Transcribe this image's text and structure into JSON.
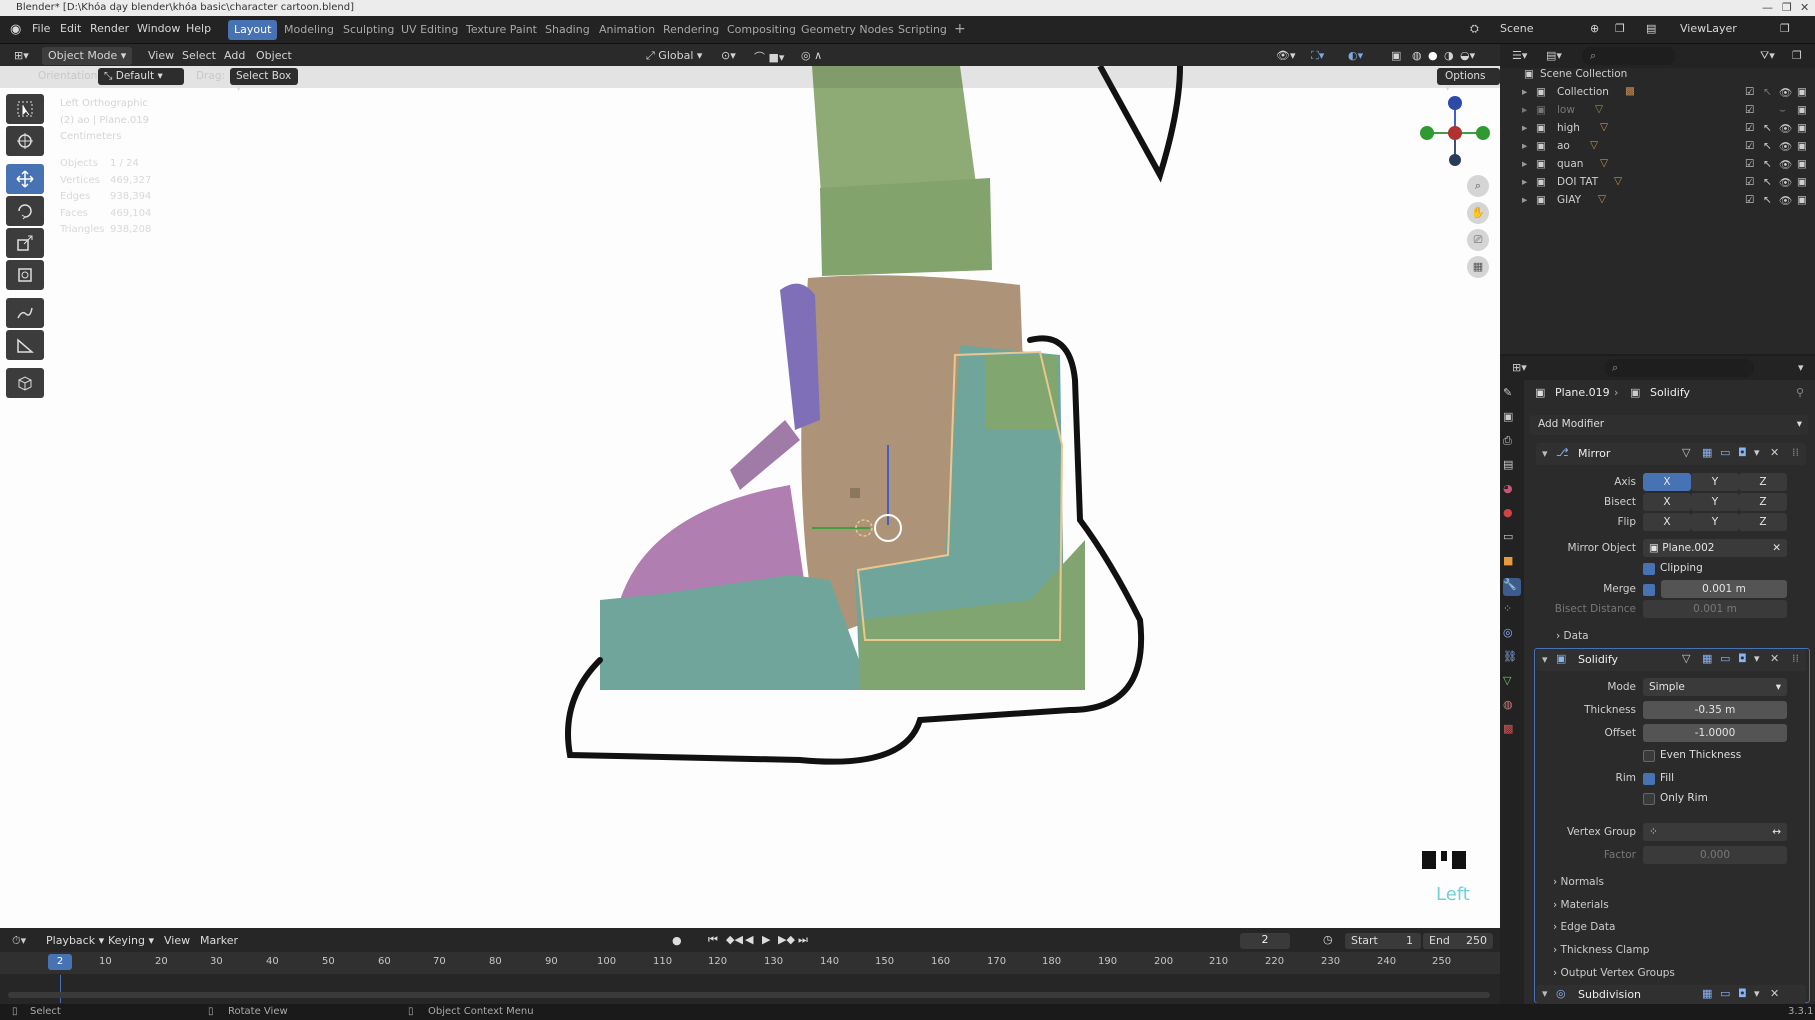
{
  "window": {
    "title": "Blender* [D:\\Khóa dạy blender\\khóa basic\\character cartoon.blend]"
  },
  "menu": [
    "File",
    "Edit",
    "Render",
    "Window",
    "Help"
  ],
  "workspaces": [
    "Layout",
    "Modeling",
    "Sculpting",
    "UV Editing",
    "Texture Paint",
    "Shading",
    "Animation",
    "Rendering",
    "Compositing",
    "Geometry Nodes",
    "Scripting"
  ],
  "scene": {
    "label": "Scene",
    "viewlayer": "ViewLayer"
  },
  "viewport_header": {
    "mode": "Object Mode",
    "menus": [
      "View",
      "Select",
      "Add",
      "Object"
    ],
    "transform": "Global",
    "options": "Options"
  },
  "tool_settings": {
    "orientation_label": "Orientation:",
    "orientation": "Default",
    "drag_label": "Drag:",
    "drag": "Select Box"
  },
  "overlay_info": {
    "lines": [
      "Left Orthographic",
      "(2) ao | Plane.019",
      "Centimeters"
    ],
    "stats": [
      {
        "k": "Objects",
        "v": "1 / 24"
      },
      {
        "k": "Vertices",
        "v": "469,327"
      },
      {
        "k": "Edges",
        "v": "938,394"
      },
      {
        "k": "Faces",
        "v": "469,104"
      },
      {
        "k": "Triangles",
        "v": "938,208"
      }
    ],
    "view_label": "Left"
  },
  "outliner": {
    "root": "Scene Collection",
    "items": [
      "Collection",
      "low",
      "high",
      "ao",
      "quan",
      "DOI TAT",
      "GIAY"
    ]
  },
  "properties": {
    "breadcrumb_object": "Plane.019",
    "breadcrumb_modifier": "Solidify",
    "add_modifier": "Add Modifier",
    "mirror": {
      "name": "Mirror",
      "axis_label": "Axis",
      "bisect_label": "Bisect",
      "flip_label": "Flip",
      "axes": [
        "X",
        "Y",
        "Z"
      ],
      "mirror_object_label": "Mirror Object",
      "mirror_object": "Plane.002",
      "clipping": "Clipping",
      "merge_label": "Merge",
      "merge": "0.001 m",
      "bisect_distance_label": "Bisect Distance",
      "bisect_distance": "0.001 m",
      "data": "Data"
    },
    "solidify": {
      "name": "Solidify",
      "mode_label": "Mode",
      "mode": "Simple",
      "thickness_label": "Thickness",
      "thickness": "-0.35 m",
      "offset_label": "Offset",
      "offset": "-1.0000",
      "even_thickness": "Even Thickness",
      "rim_label": "Rim",
      "fill": "Fill",
      "only_rim": "Only Rim",
      "vertex_group_label": "Vertex Group",
      "factor_label": "Factor",
      "factor": "0.000",
      "sections": [
        "Normals",
        "Materials",
        "Edge Data",
        "Thickness Clamp",
        "Output Vertex Groups"
      ]
    },
    "subdivision": {
      "name": "Subdivision"
    }
  },
  "timeline": {
    "menus": [
      "Playback",
      "Keying",
      "View",
      "Marker"
    ],
    "current_frame": "2",
    "start_label": "Start",
    "start": "1",
    "end_label": "End",
    "end": "250",
    "ticks": [
      "10",
      "20",
      "30",
      "40",
      "50",
      "60",
      "70",
      "80",
      "90",
      "100",
      "110",
      "120",
      "130",
      "140",
      "150",
      "160",
      "170",
      "180",
      "190",
      "200",
      "210",
      "220",
      "230",
      "240",
      "250"
    ]
  },
  "statusbar": {
    "select": "Select",
    "rotate": "Rotate View",
    "context": "Object Context Menu",
    "version": "3.3.1"
  },
  "colors": {
    "accent": "#4772b3",
    "pink": "#b07eb0",
    "teal": "#6fa59a",
    "green": "#80a570",
    "tan": "#ad9478",
    "purple": "#7f6fb8"
  }
}
